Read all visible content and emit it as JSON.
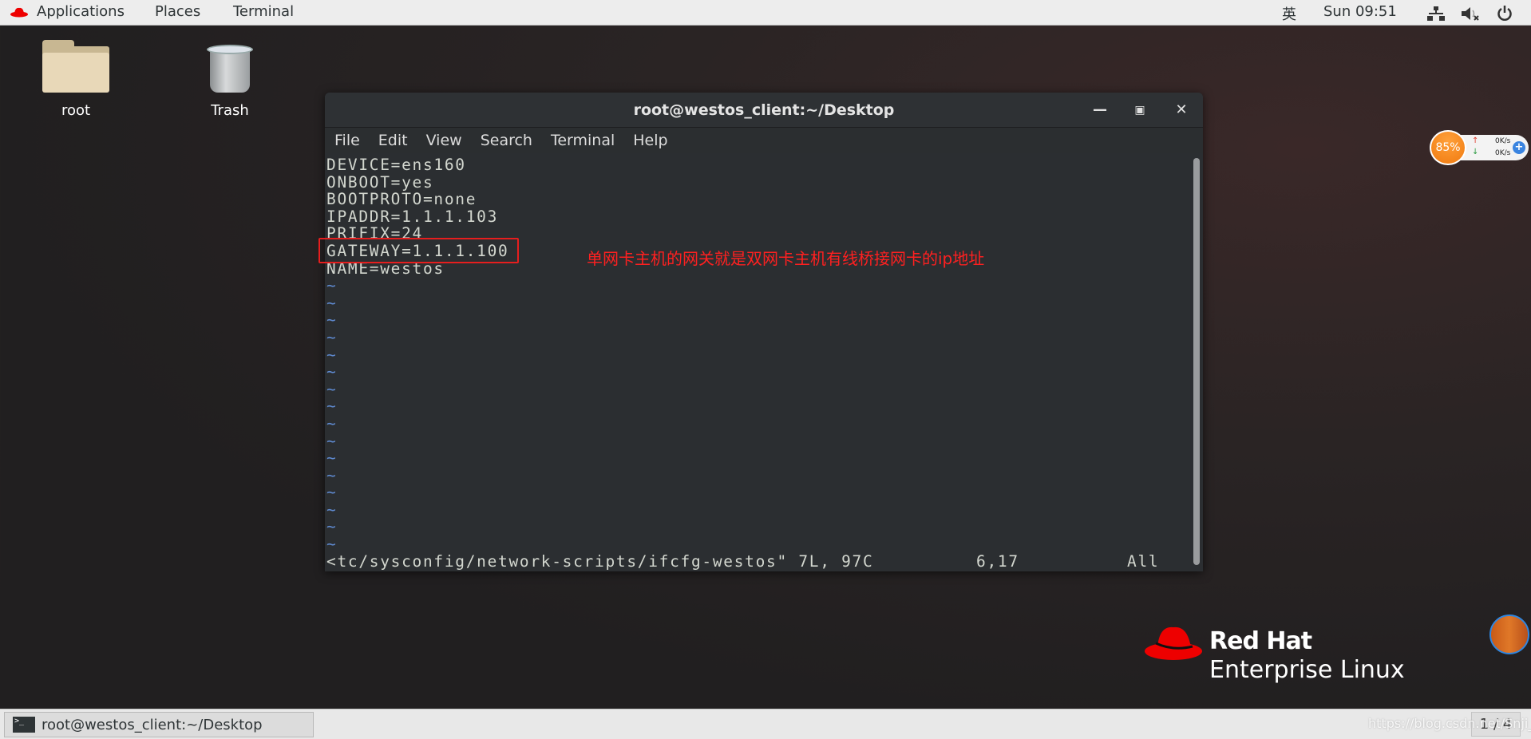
{
  "topbar": {
    "applications": "Applications",
    "places": "Places",
    "terminal": "Terminal",
    "input_method": "英",
    "clock": "Sun 09:51"
  },
  "desktop": {
    "icons": [
      {
        "label": "root"
      },
      {
        "label": "Trash"
      }
    ]
  },
  "window": {
    "title": "root@westos_client:~/Desktop",
    "menu": [
      "File",
      "Edit",
      "View",
      "Search",
      "Terminal",
      "Help"
    ],
    "lines": [
      "DEVICE=ens160",
      "ONBOOT=yes",
      "BOOTPROTO=none",
      "IPADDR=1.1.1.103",
      "PRIFIX=24",
      "GATEWAY=1.1.1.100",
      "NAME=westos"
    ],
    "tilde_count": 16,
    "status": {
      "file": "<tc/sysconfig/network-scripts/ifcfg-westos\" 7L, 97C",
      "position": "6,17",
      "scroll": "All"
    }
  },
  "annotation": {
    "text": "单网卡主机的网关就是双网卡主机有线桥接网卡的ip地址",
    "color": "#ff2020"
  },
  "net_widget": {
    "percent": "85%",
    "up": "0K/s",
    "down": "0K/s"
  },
  "branding": {
    "line1": "Red Hat",
    "line2": "Enterprise Linux"
  },
  "taskbar": {
    "window_button": "root@westos_client:~/Desktop",
    "pager": "1 / 4"
  },
  "watermark": "https://blog.csdn.net/Snji_G"
}
